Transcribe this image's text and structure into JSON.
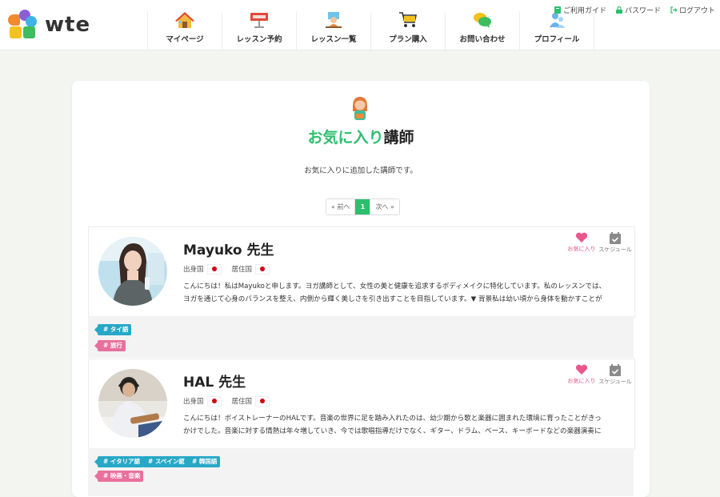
{
  "header": {
    "logo_text": "wte",
    "nav": [
      {
        "label": "マイページ",
        "icon": "house-icon"
      },
      {
        "label": "レッスン予約",
        "icon": "reservation-sign-icon"
      },
      {
        "label": "レッスン一覧",
        "icon": "teacher-desk-icon"
      },
      {
        "label": "プラン購入",
        "icon": "cart-icon"
      },
      {
        "label": "お問い合わせ",
        "icon": "chat-bubbles-icon"
      },
      {
        "label": "プロフィール",
        "icon": "people-icon"
      }
    ],
    "top_links": [
      {
        "label": "ご利用ガイド",
        "icon": "book-icon"
      },
      {
        "label": "パスワード",
        "icon": "lock-icon"
      },
      {
        "label": "ログアウト",
        "icon": "logout-icon"
      }
    ]
  },
  "page": {
    "title_accent": "お気に入り",
    "title_rest": "講師",
    "description": "お気に入りに追加した講師です。",
    "pagination": {
      "prev": "« 前へ",
      "current": "1",
      "next": "次へ »"
    }
  },
  "labels": {
    "birth_country": "出身国",
    "residence_country": "居住国",
    "favorite": "お気に入り",
    "schedule": "スケジュール"
  },
  "teachers": [
    {
      "name": "Mayuko 先生",
      "bio": "こんにちは！私はMayukoと申します。ヨガ講師として、女性の美と健康を追求するボディメイクに特化しています。私のレッスンでは、ヨガを通じて心身のバランスを整え、内側から輝く美しさを引き出すことを目指しています。▼ 背景私は幼い頃から身体を動かすことが大好",
      "tags": [
        {
          "label": "# タイ語",
          "color": "blue"
        },
        {
          "label": "# 旅行",
          "color": "pink"
        }
      ]
    },
    {
      "name": "HAL 先生",
      "bio": "こんにちは！ボイストレーナーのHALです。音楽の世界に足を踏み入れたのは、幼少期から歌と楽器に囲まれた環境に育ったことがきっかけでした。音楽に対する情熱は年々増していき、今では歌唱指導だけでなく、ギター、ドラム、ベース、キーボードなどの楽器演奏にも精通す",
      "tags": [
        {
          "label": "# イタリア語",
          "color": "blue"
        },
        {
          "label": "# スペイン語",
          "color": "blue"
        },
        {
          "label": "# 韓国語",
          "color": "blue"
        },
        {
          "label": "# 映画・音楽",
          "color": "pink"
        }
      ]
    }
  ],
  "colors": {
    "accent_green": "#2cbf6d",
    "favorite_pink": "#e8578b",
    "tag_blue": "#27a8c7",
    "tag_pink": "#e8709c"
  }
}
